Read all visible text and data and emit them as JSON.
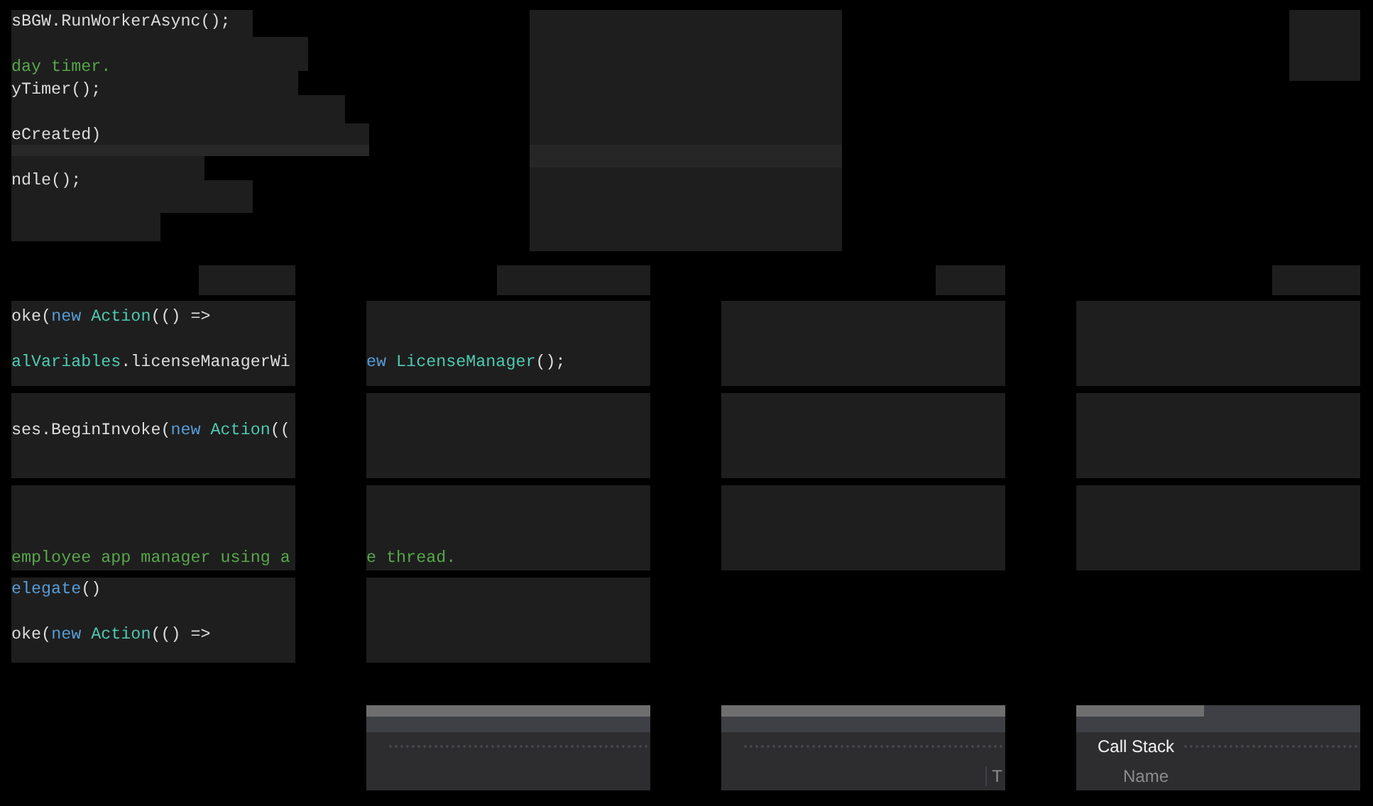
{
  "top_block": {
    "lines": [
      [
        {
          "text": "sBGW.RunWorkerAsync();",
          "kind": "plain"
        }
      ],
      [
        {
          "text": "day timer.",
          "kind": "comment"
        }
      ],
      [
        {
          "text": "yTimer();",
          "kind": "plain"
        }
      ],
      [
        {
          "text": "eCreated)",
          "kind": "plain"
        }
      ],
      [
        {
          "text": "ndle();",
          "kind": "plain"
        }
      ]
    ]
  },
  "tiles": [
    {
      "lines": [
        [
          {
            "text": "oke(",
            "kind": "plain"
          },
          {
            "text": "new ",
            "kind": "keyword"
          },
          {
            "text": "Action",
            "kind": "type"
          },
          {
            "text": "(() =>",
            "kind": "plain"
          }
        ],
        [
          {
            "text": "alVariables",
            "kind": "type"
          },
          {
            "text": ".licenseManagerWi",
            "kind": "plain"
          }
        ]
      ]
    },
    {
      "lines": [
        [
          {
            "text": "ew ",
            "kind": "keyword"
          },
          {
            "text": "LicenseManager",
            "kind": "type"
          },
          {
            "text": "();",
            "kind": "plain"
          }
        ]
      ]
    },
    {
      "lines": [
        [
          {
            "text": "ses.BeginInvoke(",
            "kind": "plain"
          },
          {
            "text": "new ",
            "kind": "keyword"
          },
          {
            "text": "Action",
            "kind": "type"
          },
          {
            "text": "((",
            "kind": "plain"
          }
        ]
      ]
    },
    {
      "lines": [
        [
          {
            "text": "employee app manager using a",
            "kind": "comment"
          }
        ]
      ]
    },
    {
      "lines": [
        [
          {
            "text": "e thread.",
            "kind": "comment"
          }
        ]
      ]
    },
    {
      "lines": [
        [
          {
            "text": "elegate",
            "kind": "keyword"
          },
          {
            "text": "()",
            "kind": "plain"
          }
        ],
        [
          {
            "text": "oke(",
            "kind": "plain"
          },
          {
            "text": "new ",
            "kind": "keyword"
          },
          {
            "text": "Action",
            "kind": "type"
          },
          {
            "text": "(() =>",
            "kind": "plain"
          }
        ]
      ]
    }
  ],
  "panels": [
    {
      "column_header": "T"
    },
    {
      "title": "Call Stack",
      "column_header": "Name"
    }
  ]
}
